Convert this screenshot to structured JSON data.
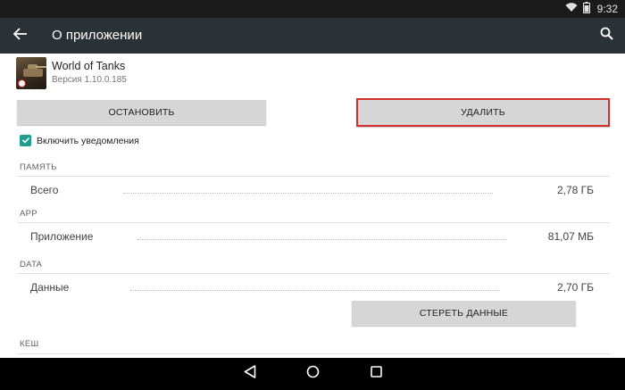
{
  "status_bar": {
    "time": "9:32"
  },
  "app_bar": {
    "title": "О приложении"
  },
  "app": {
    "name": "World of Tanks",
    "version": "Версия 1.10.0.185"
  },
  "buttons": {
    "stop": "ОСТАНОВИТЬ",
    "delete": "УДАЛИТЬ",
    "clear_data": "СТЕРЕТЬ ДАННЫЕ"
  },
  "notifications": {
    "label": "Включить уведомления",
    "checked": true
  },
  "sections": {
    "memory": {
      "header": "ПАМЯТЬ",
      "row_label": "Всего",
      "row_value": "2,78 ГБ"
    },
    "app": {
      "header": "APP",
      "row_label": "Приложение",
      "row_value": "81,07 МБ"
    },
    "data": {
      "header": "DATA",
      "row_label": "Данные",
      "row_value": "2,70 ГБ"
    },
    "cache": {
      "header": "КЕШ"
    }
  },
  "colors": {
    "app_bar": "#2b3236",
    "accent": "#1e9e8e",
    "highlight": "#d32f2f",
    "button": "#d6d6d6"
  },
  "icons": {
    "back": "arrow-left-icon",
    "search": "search-icon",
    "wifi": "wifi-icon",
    "battery": "battery-icon",
    "nav_back": "triangle-back-icon",
    "nav_home": "circle-home-icon",
    "nav_recent": "square-recent-icon"
  }
}
